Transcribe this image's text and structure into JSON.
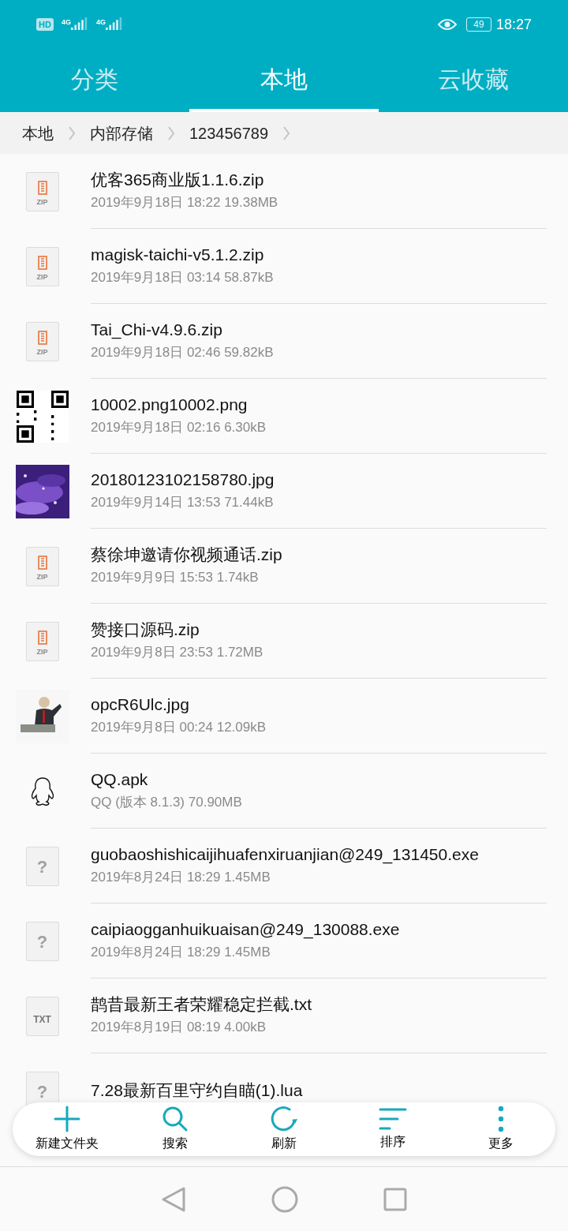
{
  "status_bar": {
    "hd": "HD",
    "networks": [
      "4G",
      "4G"
    ],
    "battery": "49",
    "time": "18:27"
  },
  "tabs": [
    {
      "label": "分类",
      "selected": false
    },
    {
      "label": "本地",
      "selected": true
    },
    {
      "label": "云收藏",
      "selected": false
    }
  ],
  "breadcrumb": [
    "本地",
    "内部存储",
    "123456789"
  ],
  "files": [
    {
      "kind": "zip",
      "icon_text": "ZIP",
      "name": "优客365商业版1.1.6.zip",
      "meta": "2019年9月18日 18:22 19.38MB"
    },
    {
      "kind": "zip",
      "icon_text": "ZIP",
      "name": "magisk-taichi-v5.1.2.zip",
      "meta": "2019年9月18日 03:14 58.87kB"
    },
    {
      "kind": "zip",
      "icon_text": "ZIP",
      "name": "Tai_Chi-v4.9.6.zip",
      "meta": "2019年9月18日 02:46 59.82kB"
    },
    {
      "kind": "qr",
      "name": "10002.png10002.png",
      "meta": "2019年9月18日 02:16 6.30kB"
    },
    {
      "name": "20180123102158780.jpg",
      "meta": "2019年9月14日 13:53 71.44kB"
    },
    {
      "kind": "zip",
      "icon_text": "ZIP",
      "name": "蔡徐坤邀请你视频通话.zip",
      "meta": "2019年9月9日 15:53 1.74kB"
    },
    {
      "kind": "zip",
      "icon_text": "ZIP",
      "name": "赞接口源码.zip",
      "meta": "2019年9月8日 23:53 1.72MB"
    },
    {
      "kind": "figure",
      "name": "opcR6Ulc.jpg",
      "meta": "2019年9月8日 00:24 12.09kB"
    },
    {
      "kind": "apk",
      "name": "QQ.apk",
      "meta": "QQ (版本 8.1.3) 70.90MB"
    },
    {
      "kind": "unknown",
      "icon_text": "?",
      "name": "guobaoshishicaijihuafenxiruanjian@249_131450.exe",
      "meta": "2019年8月24日 18:29 1.45MB"
    },
    {
      "kind": "unknown",
      "icon_text": "?",
      "name": "caipiaogganhuikuaisan@249_130088.exe",
      "meta": "2019年8月24日 18:29 1.45MB"
    },
    {
      "kind": "txt",
      "icon_text": "TXT",
      "name": "鹊昔最新王者荣耀稳定拦截.txt",
      "meta": "2019年8月19日 08:19 4.00kB"
    },
    {
      "kind": "unknown",
      "icon_text": "?",
      "name": "7.28最新百里守约自瞄(1).lua"
    }
  ],
  "toolbar": [
    {
      "kind": "add",
      "label": "新建文件夹"
    },
    {
      "kind": "search",
      "label": "搜索"
    },
    {
      "kind": "refresh",
      "label": "刷新"
    },
    {
      "kind": "sort",
      "label": "排序"
    },
    {
      "kind": "more",
      "label": "更多"
    }
  ]
}
